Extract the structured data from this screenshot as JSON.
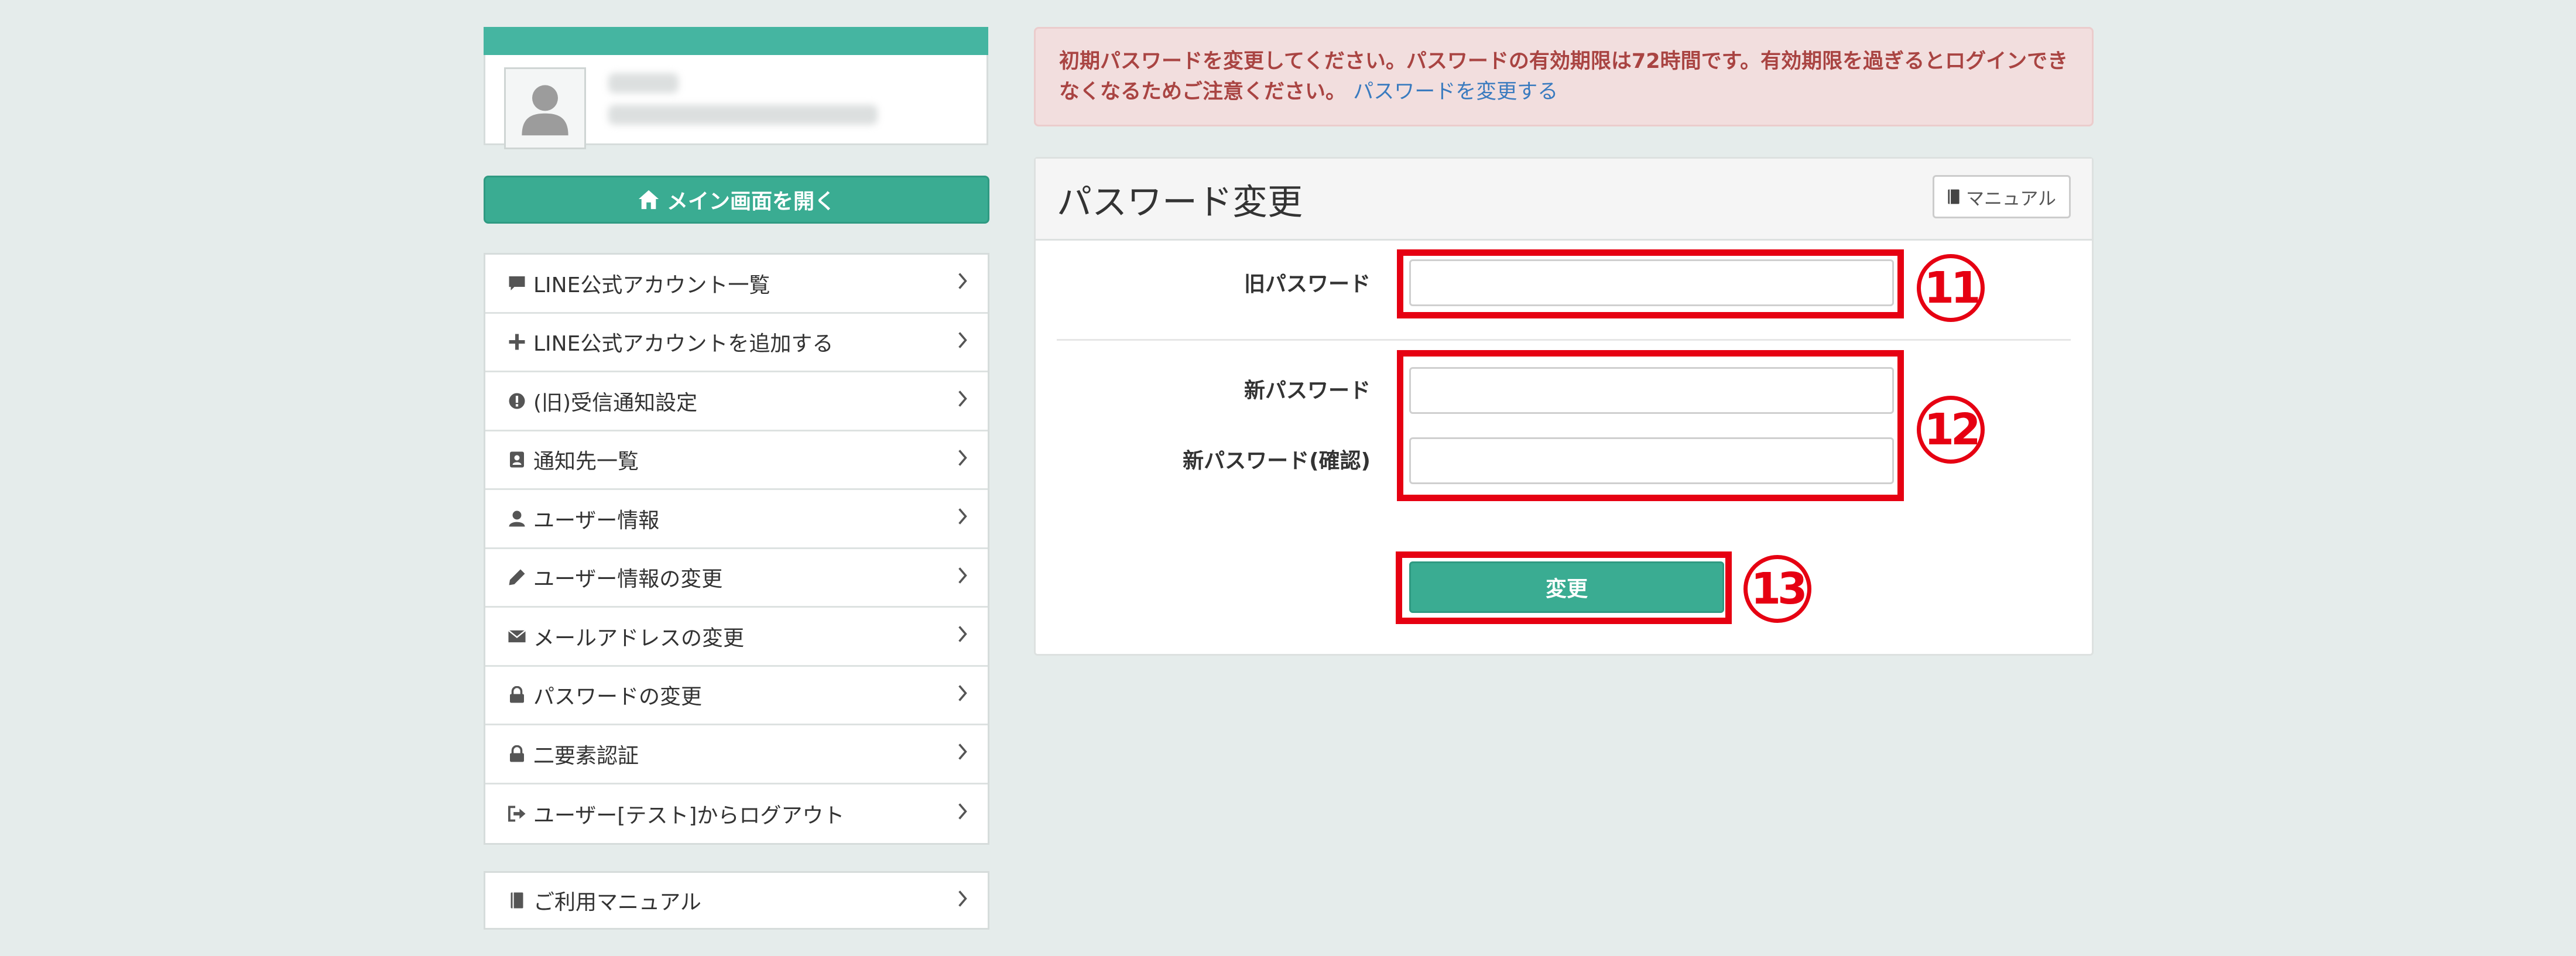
{
  "sidebar": {
    "main_button": {
      "label": "メイン画面を開く",
      "icon": "home-icon"
    },
    "menu": [
      {
        "label": "LINE公式アカウント一覧",
        "icon": "comment-icon"
      },
      {
        "label": "LINE公式アカウントを追加する",
        "icon": "plus-icon"
      },
      {
        "label": "(旧)受信通知設定",
        "icon": "alert-circle-icon"
      },
      {
        "label": "通知先一覧",
        "icon": "contact-card-icon"
      },
      {
        "label": "ユーザー情報",
        "icon": "user-icon"
      },
      {
        "label": "ユーザー情報の変更",
        "icon": "pencil-icon"
      },
      {
        "label": "メールアドレスの変更",
        "icon": "envelope-icon"
      },
      {
        "label": "パスワードの変更",
        "icon": "lock-icon"
      },
      {
        "label": "二要素認証",
        "icon": "lock-icon"
      },
      {
        "label": "ユーザー[テスト]からログアウト",
        "icon": "logout-icon"
      }
    ],
    "manual_item": {
      "label": "ご利用マニュアル",
      "icon": "book-icon"
    },
    "chevron": ">"
  },
  "alert": {
    "message": "初期パスワードを変更してください。パスワードの有効期限は72時間です。有効期限を過ぎるとログインできなくなるためご注意ください。",
    "link": "パスワードを変更する"
  },
  "panel": {
    "title": "パスワード変更",
    "manual_button": "マニュアル",
    "fields": {
      "old_password": {
        "label": "旧パスワード",
        "value": ""
      },
      "new_password": {
        "label": "新パスワード",
        "value": ""
      },
      "new_password_confirm": {
        "label": "新パスワード(確認)",
        "value": ""
      }
    },
    "submit": "変更"
  },
  "annotations": {
    "m11": "11",
    "m12": "12",
    "m13": "13"
  },
  "colors": {
    "accent": "#3aac92",
    "alert_text": "#a94442",
    "alert_bg": "#f2dede",
    "annotation": "#e60012",
    "link": "#3a7bbf"
  }
}
